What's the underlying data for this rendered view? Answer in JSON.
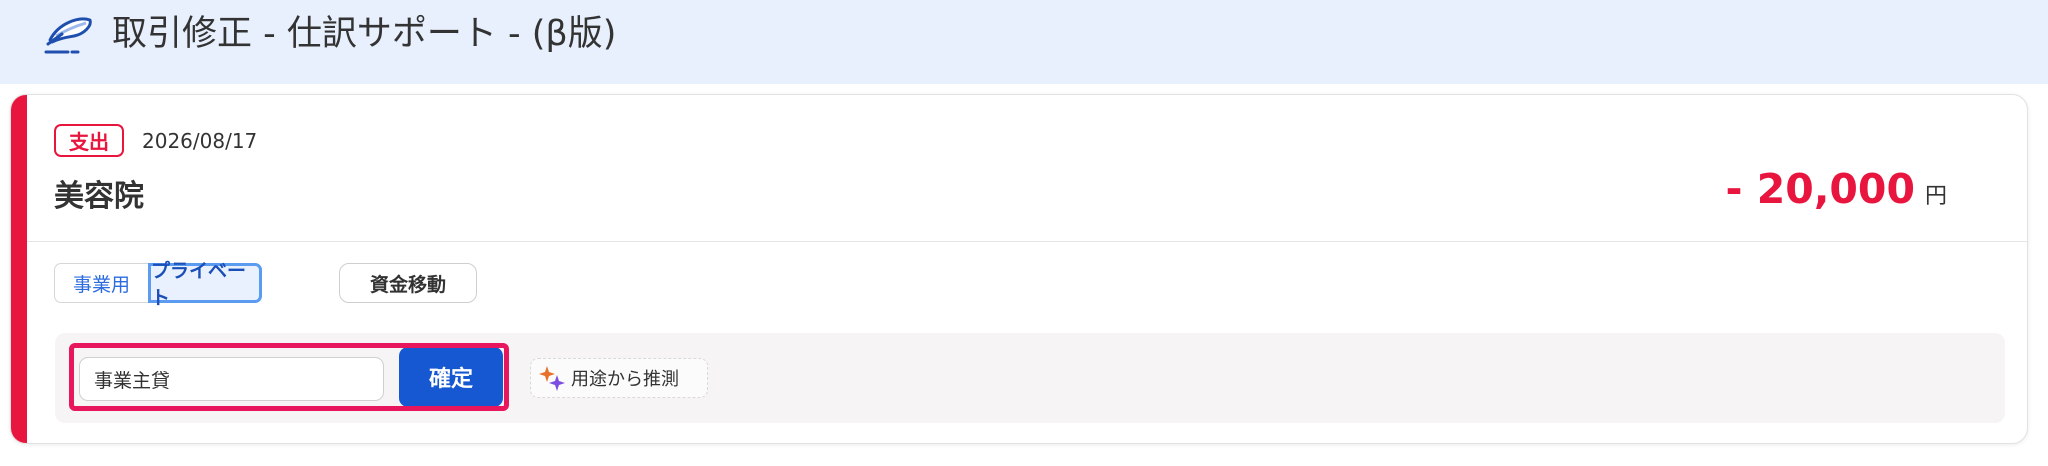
{
  "header": {
    "title": "取引修正 - 仕訳サポート - (β版)",
    "logo_icon": "feather-pen-icon"
  },
  "transaction": {
    "type_badge": "支出",
    "date": "2026/08/17",
    "merchant": "美容院",
    "amount": "- 20,000",
    "currency_unit": "円"
  },
  "category_toggle": {
    "business_label": "事業用",
    "private_label": "プライベート",
    "selected": "プライベート"
  },
  "transfer_button": {
    "label": "資金移動"
  },
  "account_form": {
    "account_value": "事業主貸",
    "confirm_label": "確定",
    "infer_label": "用途から推測",
    "infer_icon": "sparkle-icon"
  },
  "colors": {
    "accent_red": "#e8163f",
    "header_bg": "#e8f0fd",
    "primary_blue": "#1658d1",
    "highlight_pink": "#e8175d"
  }
}
